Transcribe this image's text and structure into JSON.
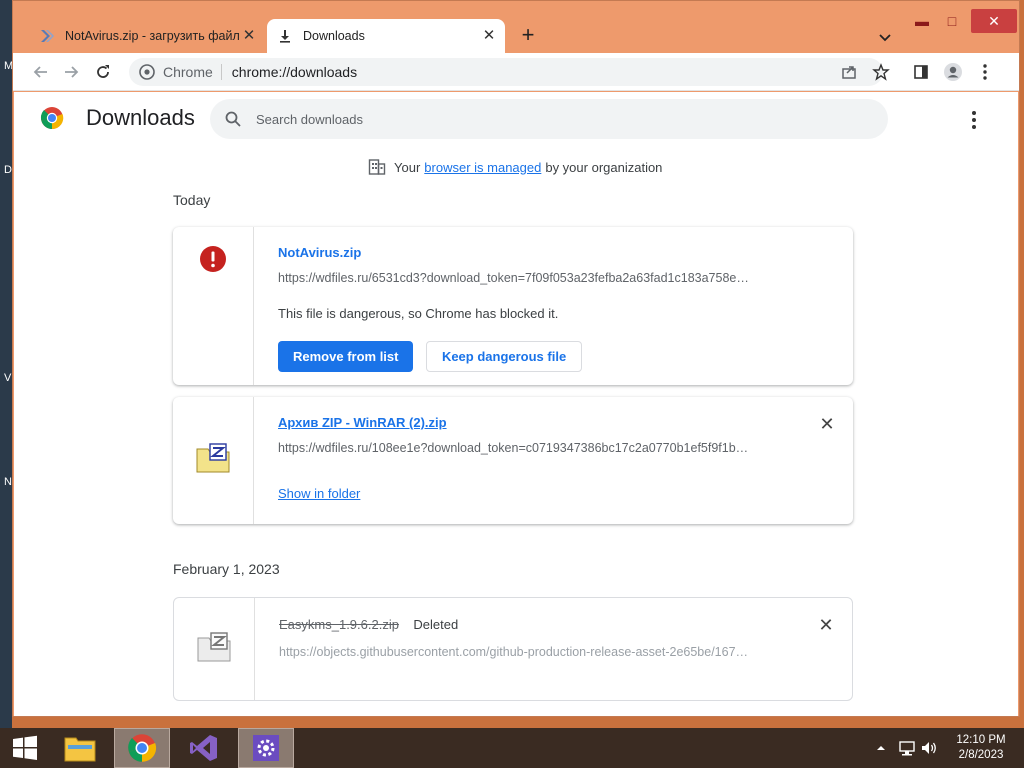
{
  "window": {
    "tabs": [
      {
        "title": "NotAvirus.zip - загрузить файл",
        "active": false
      },
      {
        "title": "Downloads",
        "active": true
      }
    ],
    "controls": {
      "minimize": "▬",
      "maximize": "□",
      "close": "✕"
    }
  },
  "toolbar": {
    "site_chip": "Chrome",
    "url": "chrome://downloads"
  },
  "downloads_page": {
    "title": "Downloads",
    "search_placeholder": "Search downloads",
    "managed": {
      "prefix": "Your",
      "link": "browser is managed",
      "suffix": "by your organization"
    },
    "groups": [
      {
        "date": "Today",
        "items": [
          {
            "file_name": "NotAvirus.zip",
            "url": "https://wdfiles.ru/6531cd3?download_token=7f09f053a23fefba2a63fad1c183a758e…",
            "warning": "This file is dangerous, so Chrome has blocked it.",
            "primary_action": "Remove from list",
            "secondary_action": "Keep dangerous file"
          },
          {
            "file_name": "Архив ZIP - WinRAR (2).zip",
            "url": "https://wdfiles.ru/108ee1e?download_token=c0719347386bc17c2a0770b1ef5f9f1b…",
            "action": "Show in folder"
          }
        ]
      },
      {
        "date": "February 1, 2023",
        "items": [
          {
            "file_name": "Easykms_1.9.6.2.zip",
            "status": "Deleted",
            "url": "https://objects.githubusercontent.com/github-production-release-asset-2e65be/167…"
          }
        ]
      }
    ]
  },
  "desktop": {
    "edge_letters": [
      "M",
      "D",
      "V",
      "N"
    ]
  },
  "taskbar": {
    "clock_time": "12:10 PM",
    "clock_date": "2/8/2023"
  },
  "colors": {
    "accent": "#1a73e8",
    "window_frame": "#ee9a6c",
    "danger": "#c5221f",
    "taskbar": "#3a2b22"
  }
}
